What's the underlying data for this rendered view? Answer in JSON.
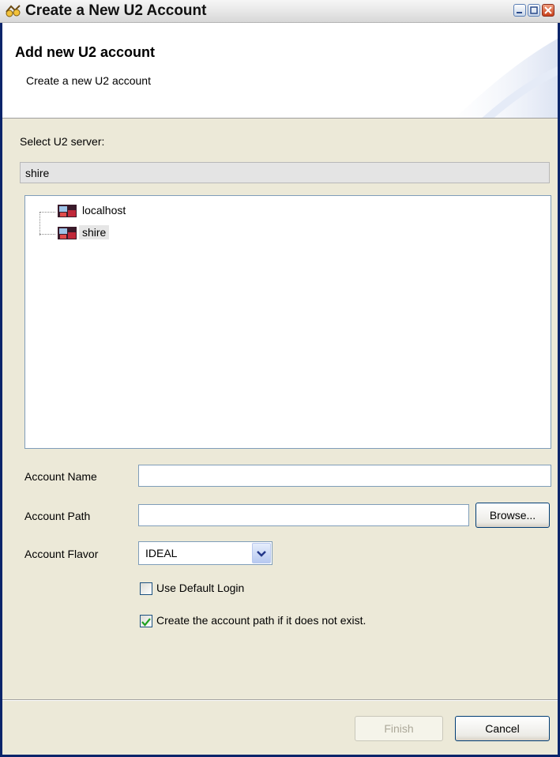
{
  "window": {
    "title": "Create a New U2 Account",
    "icon": "wizard-icon"
  },
  "banner": {
    "title": "Add new U2 account",
    "subtitle": "Create a new U2 account"
  },
  "server": {
    "label": "Select U2 server:",
    "value": "shire",
    "tree": [
      {
        "label": "localhost",
        "icon": "server-icon",
        "selected": false
      },
      {
        "label": "shire",
        "icon": "server-icon",
        "selected": true
      }
    ]
  },
  "form": {
    "account_name_label": "Account Name",
    "account_name_value": "",
    "account_path_label": "Account Path",
    "account_path_value": "",
    "browse_label": "Browse...",
    "account_flavor_label": "Account Flavor",
    "account_flavor_value": "IDEAL",
    "use_default_login_label": "Use Default Login",
    "use_default_login_checked": false,
    "create_path_label": "Create the account path if it does not exist.",
    "create_path_checked": true
  },
  "buttons": {
    "finish": "Finish",
    "cancel": "Cancel"
  }
}
